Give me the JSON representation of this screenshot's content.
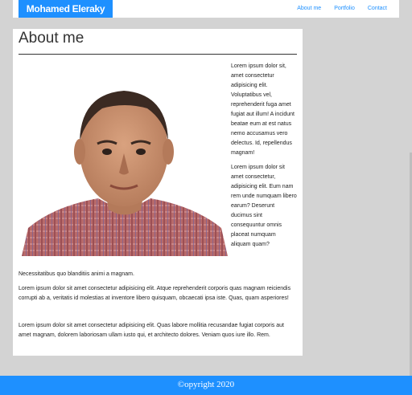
{
  "navbar": {
    "brand": "Mohamed Eleraky",
    "links": [
      "About me",
      "Portfolio",
      "Contact"
    ]
  },
  "main": {
    "title": "About me",
    "side_paragraphs": [
      "Lorem ipsum dolor sit, amet consectetur adipisicing elit. Voluptatibus vel, reprehenderit fuga amet fugiat aut illum! A incidunt beatae eum at est natus nemo accusamus vero delectus. Id, repellendus magnam!",
      "Lorem ipsum dolor sit amet consectetur, adipisicing elit. Eum nam rem unde numquam libero earum? Deserunt ducimus sint consequuntur omnis placeat numquam aliquam quam?"
    ],
    "continued_text": "Necessitatibus quo blanditiis animi a magnam.",
    "paragraphs": [
      "Lorem ipsum dolor sit amet consectetur adipisicing elit. Atque reprehenderit corporis quas magnam reiciendis corrupti ab a, veritatis id molestias at inventore libero quisquam, obcaecati ipsa iste. Quas, quam asperiores!",
      "Lorem ipsum dolor sit amet consectetur adipisicing elit. Quas labore mollitia recusandae fugiat corporis aut amet magnam, dolorem laboriosam ullam iusto qui, et architecto dolores. Veniam quos iure illo. Rem."
    ]
  },
  "footer": {
    "text": "©opyright 2020"
  },
  "colors": {
    "accent": "#1e90ff",
    "page_background": "#d3d3d3",
    "card": "#ffffff"
  }
}
